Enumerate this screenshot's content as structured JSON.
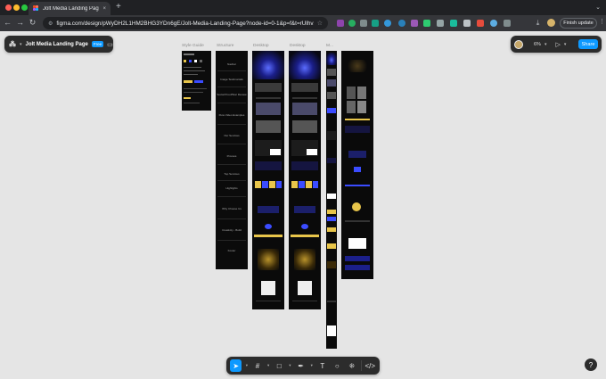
{
  "browser": {
    "tab_title": "Jolt Media Landing Page – Fig",
    "tab_close": "×",
    "new_tab": "+",
    "url": "figma.com/design/pWyDH2L1HM2BHG3YDn6gE/Jolt-Media-Landing-Page?node-id=0-1&p=f&t=rUlhvzik...",
    "finish_update": "Finish update",
    "icons": [
      "back-icon",
      "forward-icon",
      "reload-icon",
      "site-info-icon",
      "bookmark-star-icon",
      "download-icon",
      "profile-avatar-icon",
      "kebab-menu-icon"
    ]
  },
  "figma": {
    "file_name": "Jolt Media Landing Page",
    "plan": "Free",
    "zoom": "6%",
    "share": "Share",
    "help": "?",
    "frame_labels": [
      "Style Guide",
      "Structure",
      "Desktop",
      "Desktop",
      "M..."
    ],
    "structure_items": [
      "Navbar",
      "Image Testimonials",
      "Social Proof/Star Review",
      "Flow Video Examples",
      "Our Services",
      "Process",
      "Top Services",
      "Highlights",
      "Why Choose Us",
      "Creativity - Build",
      "Footer"
    ],
    "tools": [
      "move-tool",
      "frame-tool",
      "shape-tool",
      "pen-tool",
      "text-tool",
      "comment-tool",
      "actions-tool",
      "dev-mode-tool"
    ],
    "colors": {
      "canvas": "#e5e5e5",
      "panel": "#2c2c2c",
      "accent": "#0d99ff",
      "hero_blue": "#3b4cff",
      "gold": "#e8c54a"
    }
  }
}
